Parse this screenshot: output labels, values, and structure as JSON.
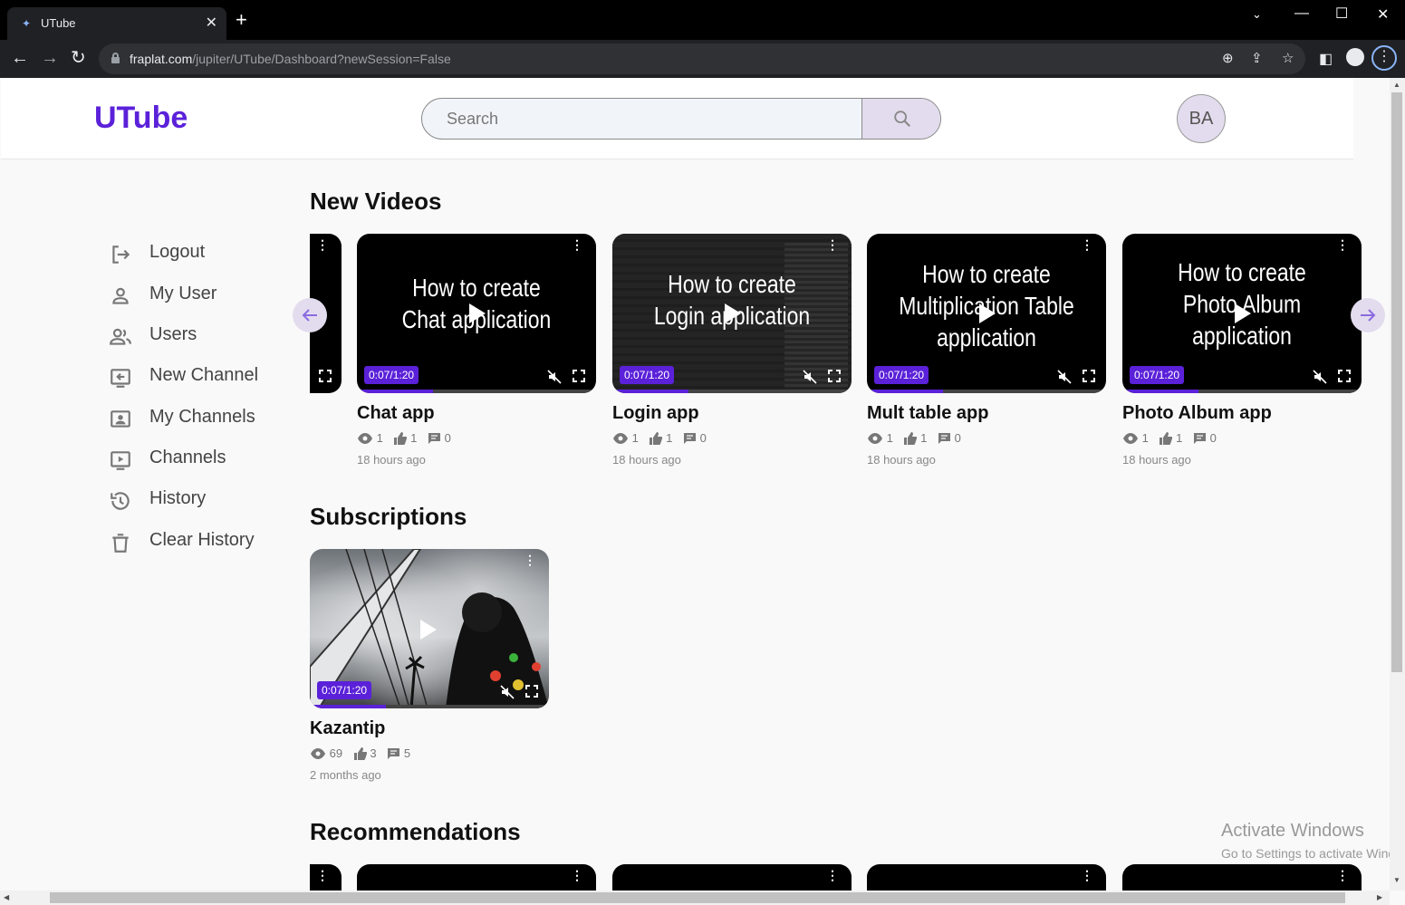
{
  "browser": {
    "tab_title": "UTube",
    "tab_close": "✕",
    "new_tab": "+",
    "url_host": "fraplat.com",
    "url_path": "/jupiter/UTube/Dashboard?newSession=False",
    "back": "←",
    "forward": "→",
    "reload": "↻"
  },
  "header": {
    "logo": "UTube",
    "search_placeholder": "Search",
    "avatar_initials": "BA"
  },
  "sidebar": {
    "items": [
      {
        "label": "Logout",
        "icon": "logout-icon"
      },
      {
        "label": "My User",
        "icon": "user-icon"
      },
      {
        "label": "Users",
        "icon": "users-icon"
      },
      {
        "label": "New Channel",
        "icon": "new-channel-icon"
      },
      {
        "label": "My Channels",
        "icon": "my-channels-icon"
      },
      {
        "label": "Channels",
        "icon": "channels-icon"
      },
      {
        "label": "History",
        "icon": "history-icon"
      },
      {
        "label": "Clear History",
        "icon": "trash-icon"
      }
    ]
  },
  "accent_color": "#5b21d9",
  "sections": {
    "new_videos": {
      "title": "New Videos",
      "videos": [
        {
          "title": "Chat app",
          "thumb_text": [
            "How to create",
            "Chat application"
          ],
          "time": "0:07/1:20",
          "views": "1",
          "likes": "1",
          "comments": "0",
          "age": "18 hours ago"
        },
        {
          "title": "Login app",
          "thumb_text": [
            "How to create",
            "Login application"
          ],
          "time": "0:07/1:20",
          "views": "1",
          "likes": "1",
          "comments": "0",
          "age": "18 hours ago"
        },
        {
          "title": "Mult table app",
          "thumb_text": [
            "How to create",
            "Multiplication Table",
            "application"
          ],
          "time": "0:07/1:20",
          "views": "1",
          "likes": "1",
          "comments": "0",
          "age": "18 hours ago"
        },
        {
          "title": "Photo Album app",
          "thumb_text": [
            "How to create",
            "Photo Album",
            "application"
          ],
          "time": "0:07/1:20",
          "views": "1",
          "likes": "1",
          "comments": "0",
          "age": "18 hours ago"
        }
      ],
      "progress": 0.32
    },
    "subscriptions": {
      "title": "Subscriptions",
      "videos": [
        {
          "title": "Kazantip",
          "time": "0:07/1:20",
          "views": "69",
          "likes": "3",
          "comments": "5",
          "age": "2 months ago"
        }
      ],
      "progress": 0.32
    },
    "recommendations": {
      "title": "Recommendations"
    }
  },
  "watermark": {
    "line1": "Activate Windows",
    "line2": "Go to Settings to activate Windows."
  }
}
